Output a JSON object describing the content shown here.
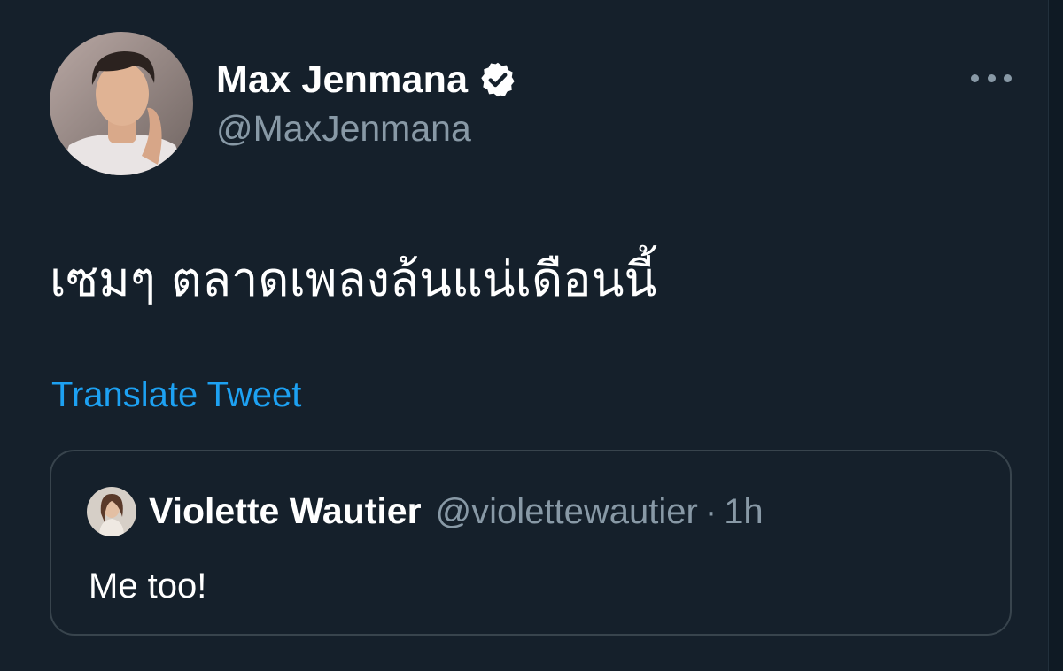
{
  "author": {
    "display_name": "Max Jenmana",
    "handle": "@MaxJenmana",
    "verified": true,
    "avatar_icon": "avatar-photo"
  },
  "tweet": {
    "text": "เซมๆ ตลาดเพลงล้นแน่เดือนนี้",
    "translate_label": "Translate Tweet"
  },
  "quoted_tweet": {
    "display_name": "Violette Wautier",
    "handle": "@violettewautier",
    "separator": "·",
    "time": "1h",
    "text": "Me too!"
  },
  "colors": {
    "background": "#15202b",
    "link": "#1da1f2",
    "secondary_text": "#8899a6",
    "border": "#38444d"
  }
}
